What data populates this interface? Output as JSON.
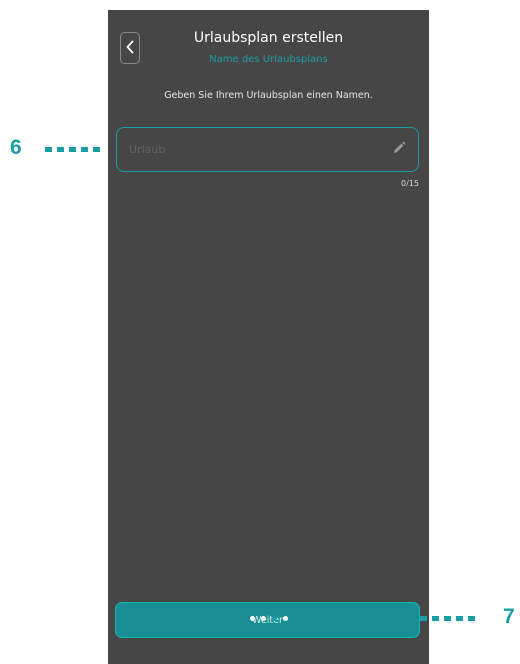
{
  "header": {
    "back_icon": "chevron-left-icon",
    "title": "Urlaubsplan erstellen",
    "subtitle": "Name des Urlaubsplans"
  },
  "instruction": "Geben Sie Ihrem Urlaubsplan einen Namen.",
  "name_field": {
    "value": "",
    "placeholder": "Urlaub",
    "edit_icon": "pencil-icon",
    "counter": "0/15"
  },
  "next_button": {
    "label": "Weiter"
  },
  "pager": {
    "total": 4,
    "active_index": 2
  },
  "callouts": {
    "field": "6",
    "button": "7"
  },
  "colors": {
    "accent": "#1a9ea5",
    "background": "#464646"
  }
}
